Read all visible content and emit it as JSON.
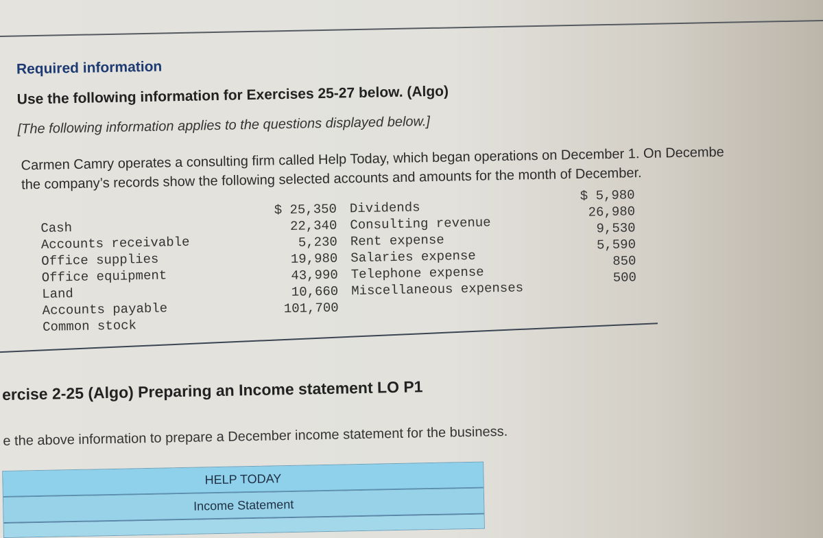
{
  "header": {
    "required_title": "Required information",
    "use_line": "Use the following information for Exercises 25-27 below. (Algo)",
    "applies_note": "[The following information applies to the questions displayed below.]"
  },
  "intro": {
    "line1": "Carmen Camry operates a consulting firm called Help Today, which began operations on December 1. On Decembe",
    "line2": "the company’s records show the following selected accounts and amounts for the month of December."
  },
  "accounts_left": [
    {
      "name": "Cash",
      "amount": "$ 25,350"
    },
    {
      "name": "Accounts receivable",
      "amount": "22,340"
    },
    {
      "name": "Office supplies",
      "amount": "5,230"
    },
    {
      "name": "Office equipment",
      "amount": "19,980"
    },
    {
      "name": "Land",
      "amount": "43,990"
    },
    {
      "name": "Accounts payable",
      "amount": "10,660"
    },
    {
      "name": "Common stock",
      "amount": "101,700"
    }
  ],
  "accounts_right": [
    {
      "name": "Dividends",
      "amount": "$ 5,980"
    },
    {
      "name": "Consulting revenue",
      "amount": "26,980"
    },
    {
      "name": "Rent expense",
      "amount": "9,530"
    },
    {
      "name": "Salaries expense",
      "amount": "5,590"
    },
    {
      "name": "Telephone expense",
      "amount": "850"
    },
    {
      "name": "Miscellaneous expenses",
      "amount": "500"
    }
  ],
  "exercise": {
    "title": "ercise 2-25 (Algo) Preparing an Income statement LO P1",
    "instruction": "e the above information to prepare a December income statement for the business."
  },
  "statement": {
    "company": "HELP TODAY",
    "title": "Income Statement"
  },
  "colors": {
    "heading_blue": "#1d3a72",
    "table_header_blue": "#8fd0ea"
  }
}
